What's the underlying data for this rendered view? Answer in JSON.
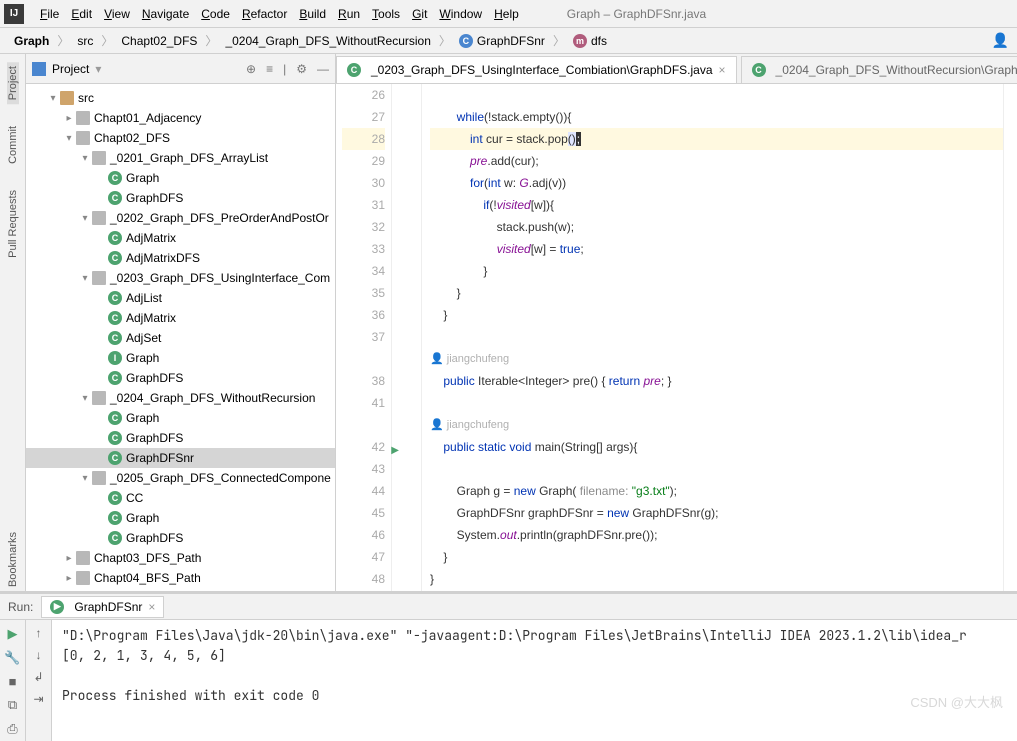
{
  "menubar": {
    "items": [
      "File",
      "Edit",
      "View",
      "Navigate",
      "Code",
      "Refactor",
      "Build",
      "Run",
      "Tools",
      "Git",
      "Window",
      "Help"
    ],
    "title": "Graph – GraphDFSnr.java"
  },
  "breadcrumb": {
    "items": [
      "Graph",
      "src",
      "Chapt02_DFS",
      "_0204_Graph_DFS_WithoutRecursion",
      "GraphDFSnr",
      "dfs"
    ]
  },
  "sidebar": {
    "title": "Project",
    "tree": [
      {
        "depth": 1,
        "twisty": "down",
        "icon": "folder",
        "label": "src"
      },
      {
        "depth": 2,
        "twisty": "right",
        "icon": "pkg",
        "label": "Chapt01_Adjacency"
      },
      {
        "depth": 2,
        "twisty": "down",
        "icon": "pkg",
        "label": "Chapt02_DFS"
      },
      {
        "depth": 3,
        "twisty": "down",
        "icon": "pkg",
        "label": "_0201_Graph_DFS_ArrayList"
      },
      {
        "depth": 4,
        "twisty": "none",
        "icon": "class",
        "label": "Graph"
      },
      {
        "depth": 4,
        "twisty": "none",
        "icon": "class",
        "label": "GraphDFS"
      },
      {
        "depth": 3,
        "twisty": "down",
        "icon": "pkg",
        "label": "_0202_Graph_DFS_PreOrderAndPostOr"
      },
      {
        "depth": 4,
        "twisty": "none",
        "icon": "class",
        "label": "AdjMatrix"
      },
      {
        "depth": 4,
        "twisty": "none",
        "icon": "class",
        "label": "AdjMatrixDFS"
      },
      {
        "depth": 3,
        "twisty": "down",
        "icon": "pkg",
        "label": "_0203_Graph_DFS_UsingInterface_Com"
      },
      {
        "depth": 4,
        "twisty": "none",
        "icon": "class",
        "label": "AdjList"
      },
      {
        "depth": 4,
        "twisty": "none",
        "icon": "class",
        "label": "AdjMatrix"
      },
      {
        "depth": 4,
        "twisty": "none",
        "icon": "class",
        "label": "AdjSet"
      },
      {
        "depth": 4,
        "twisty": "none",
        "icon": "iface",
        "label": "Graph"
      },
      {
        "depth": 4,
        "twisty": "none",
        "icon": "class",
        "label": "GraphDFS"
      },
      {
        "depth": 3,
        "twisty": "down",
        "icon": "pkg",
        "label": "_0204_Graph_DFS_WithoutRecursion"
      },
      {
        "depth": 4,
        "twisty": "none",
        "icon": "class",
        "label": "Graph"
      },
      {
        "depth": 4,
        "twisty": "none",
        "icon": "class",
        "label": "GraphDFS"
      },
      {
        "depth": 4,
        "twisty": "none",
        "icon": "class",
        "label": "GraphDFSnr",
        "selected": true
      },
      {
        "depth": 3,
        "twisty": "down",
        "icon": "pkg",
        "label": "_0205_Graph_DFS_ConnectedCompone"
      },
      {
        "depth": 4,
        "twisty": "none",
        "icon": "class",
        "label": "CC"
      },
      {
        "depth": 4,
        "twisty": "none",
        "icon": "class",
        "label": "Graph"
      },
      {
        "depth": 4,
        "twisty": "none",
        "icon": "class",
        "label": "GraphDFS"
      },
      {
        "depth": 2,
        "twisty": "right",
        "icon": "pkg",
        "label": "Chapt03_DFS_Path"
      },
      {
        "depth": 2,
        "twisty": "right",
        "icon": "pkg",
        "label": "Chapt04_BFS_Path"
      }
    ]
  },
  "tabs": {
    "items": [
      {
        "label": "_0203_Graph_DFS_UsingInterface_Combiation\\GraphDFS.java",
        "active": true
      },
      {
        "label": "_0204_Graph_DFS_WithoutRecursion\\Graph",
        "active": false
      }
    ]
  },
  "editor": {
    "first_line": 26,
    "highlighted_line": 28,
    "run_marker_line": 42,
    "author": "jiangchufeng"
  },
  "left_rail": {
    "items": [
      "Project",
      "Commit",
      "Pull Requests",
      "Bookmarks"
    ]
  },
  "run": {
    "label": "Run:",
    "tab": "GraphDFSnr",
    "console_lines": [
      "\"D:\\Program Files\\Java\\jdk-20\\bin\\java.exe\" \"-javaagent:D:\\Program Files\\JetBrains\\IntelliJ IDEA 2023.1.2\\lib\\idea_r",
      "[0, 2, 1, 3, 4, 5, 6]",
      "",
      "Process finished with exit code 0"
    ]
  },
  "watermark": "CSDN @大大枫"
}
